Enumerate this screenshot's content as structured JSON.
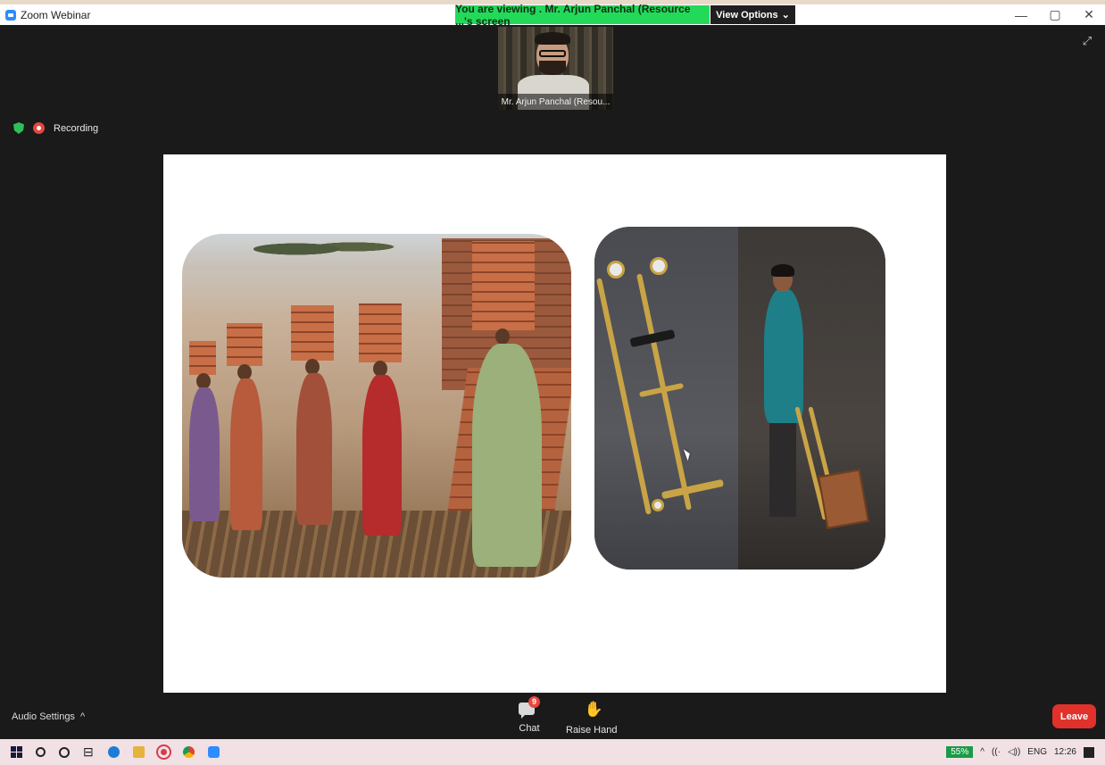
{
  "window": {
    "title": "Zoom Webinar",
    "viewing_banner": "You are viewing . Mr. Arjun Panchal (Resource ...'s screen",
    "view_options": "View Options",
    "minimize": "—",
    "restore": "▢",
    "close": "✕"
  },
  "speaker": {
    "name": "Mr. Arjun Panchal (Resou..."
  },
  "status": {
    "recording_label": "Recording"
  },
  "controls": {
    "audio_settings": "Audio Settings",
    "audio_caret": "^",
    "chat_label": "Chat",
    "chat_badge": "9",
    "raise_hand_label": "Raise Hand",
    "leave_label": "Leave"
  },
  "taskbar": {
    "battery": "55%",
    "language": "ENG",
    "time": "12:26"
  },
  "colors": {
    "banner_green": "#23d959",
    "leave_red": "#e0312b",
    "zoom_blue": "#2d8cff"
  }
}
